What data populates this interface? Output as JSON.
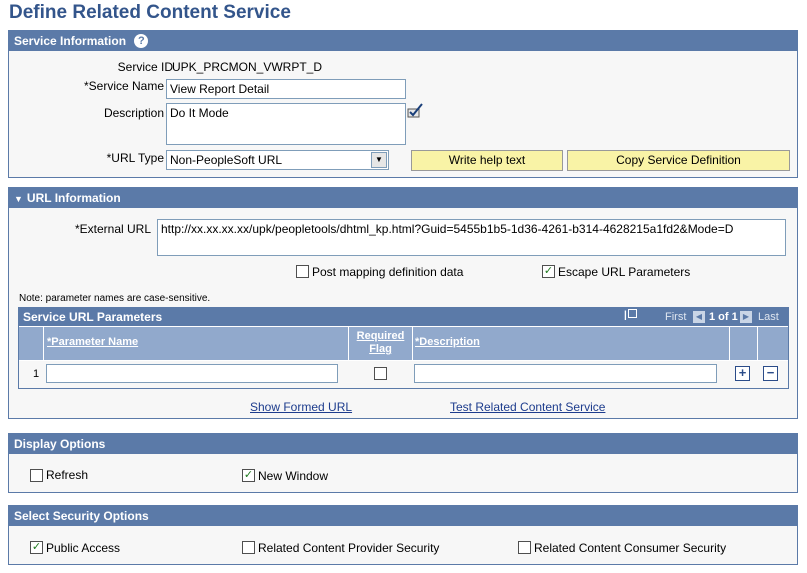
{
  "page": {
    "title": "Define Related Content Service"
  },
  "service_info": {
    "header": "Service Information",
    "help_icon": "?",
    "service_id_label": "Service ID",
    "service_id_value": "UPK_PRCMON_VWRPT_D",
    "service_name_label": "*Service Name",
    "service_name_value": "View Report Detail",
    "description_label": "Description",
    "description_value": "Do It Mode",
    "spellcheck_icon": "spellcheck-icon",
    "url_type_label": "*URL Type",
    "url_type_value": "Non-PeopleSoft URL",
    "write_help_button": "Write help text",
    "copy_service_button": "Copy Service Definition"
  },
  "url_info": {
    "header": "URL Information",
    "external_url_label": "*External URL",
    "external_url_value": "http://xx.xx.xx.xx/upk/peopletools/dhtml_kp.html?Guid=5455b1b5-1d36-4261-b314-4628215a1fd2&Mode=D",
    "post_mapping_label": "Post mapping definition data",
    "post_mapping_checked": false,
    "escape_url_label": "Escape URL Parameters",
    "escape_url_checked": true,
    "note": "Note: parameter names are case-sensitive.",
    "grid": {
      "title": "Service URL Parameters",
      "first_label": "First",
      "page_info": "1 of 1",
      "last_label": "Last",
      "columns": {
        "parameter_name": "*Parameter Name",
        "required_flag_line1": "Required",
        "required_flag_line2": "Flag",
        "description": "*Description"
      },
      "rows": [
        {
          "num": "1",
          "parameter_name": "",
          "required": false,
          "description": ""
        }
      ]
    },
    "show_formed_url_link": "Show Formed URL",
    "test_service_link": "Test Related Content Service"
  },
  "display_options": {
    "header": "Display Options",
    "refresh_label": "Refresh",
    "refresh_checked": false,
    "new_window_label": "New Window",
    "new_window_checked": true
  },
  "security_options": {
    "header": "Select Security Options",
    "public_access_label": "Public Access",
    "public_access_checked": true,
    "provider_security_label": "Related Content Provider Security",
    "provider_security_checked": false,
    "consumer_security_label": "Related Content Consumer Security",
    "consumer_security_checked": false
  },
  "colors": {
    "header_bg": "#5b7aa8",
    "title": "#33558b",
    "button_yellow": "#f9f3a6",
    "link": "#1d3c8d"
  }
}
